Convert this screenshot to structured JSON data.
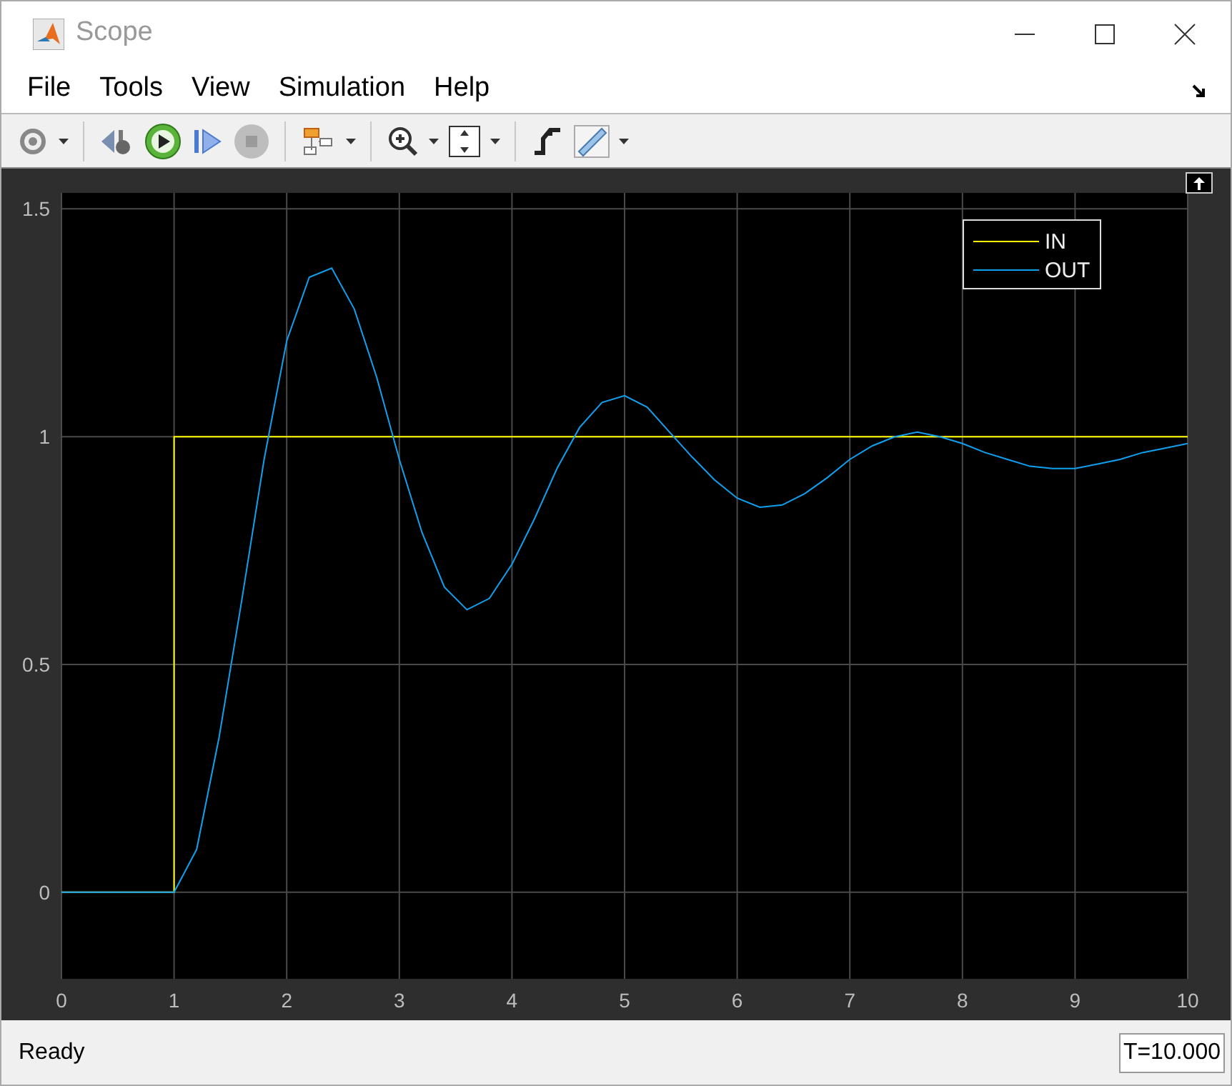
{
  "window": {
    "title": "Scope"
  },
  "menu": [
    "File",
    "Tools",
    "View",
    "Simulation",
    "Help"
  ],
  "plot": {
    "chart_data": {
      "type": "line",
      "grid": true,
      "legend": true,
      "xlim": [
        0,
        10
      ],
      "ylim": [
        -0.19,
        1.535
      ],
      "xticks": [
        0,
        1,
        2,
        3,
        4,
        5,
        6,
        7,
        8,
        9,
        10
      ],
      "yticks": [
        0,
        0.5,
        1,
        1.5
      ],
      "x": [
        0,
        1,
        1,
        1.2,
        1.4,
        1.6,
        1.8,
        2.0,
        2.2,
        2.4,
        2.6,
        2.8,
        3.0,
        3.2,
        3.4,
        3.6,
        3.8,
        4.0,
        4.2,
        4.4,
        4.6,
        4.8,
        5.0,
        5.2,
        5.4,
        5.6,
        5.8,
        6.0,
        6.2,
        6.4,
        6.6,
        6.8,
        7.0,
        7.2,
        7.4,
        7.6,
        7.8,
        8.0,
        8.2,
        8.4,
        8.6,
        8.8,
        9.0,
        9.2,
        9.4,
        9.6,
        9.8,
        10
      ],
      "series": [
        {
          "name": "IN",
          "color": "#ffff00",
          "values": [
            0,
            0,
            1,
            1,
            1,
            1,
            1,
            1,
            1,
            1,
            1,
            1,
            1,
            1,
            1,
            1,
            1,
            1,
            1,
            1,
            1,
            1,
            1,
            1,
            1,
            1,
            1,
            1,
            1,
            1,
            1,
            1,
            1,
            1,
            1,
            1,
            1,
            1,
            1,
            1,
            1,
            1,
            1,
            1,
            1,
            1,
            1,
            1
          ]
        },
        {
          "name": "OUT",
          "color": "#0fa0f0",
          "values": [
            0,
            0,
            0,
            0.094,
            0.34,
            0.64,
            0.95,
            1.21,
            1.35,
            1.37,
            1.28,
            1.13,
            0.95,
            0.79,
            0.67,
            0.62,
            0.645,
            0.72,
            0.82,
            0.93,
            1.02,
            1.075,
            1.09,
            1.065,
            1.01,
            0.955,
            0.905,
            0.865,
            0.845,
            0.85,
            0.875,
            0.91,
            0.95,
            0.98,
            1.0,
            1.01,
            1.0,
            0.985,
            0.965,
            0.95,
            0.935,
            0.93,
            0.93,
            0.94,
            0.95,
            0.965,
            0.975,
            0.985
          ]
        }
      ]
    }
  },
  "status": {
    "message": "Ready",
    "time": "T=10.000"
  }
}
